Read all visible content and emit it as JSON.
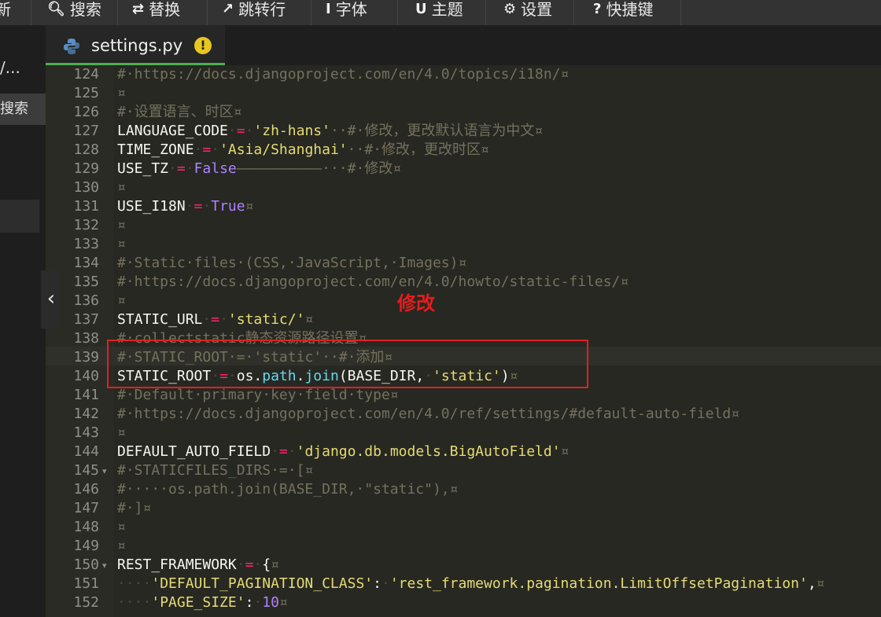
{
  "toolbar": {
    "items": [
      {
        "label": "新",
        "icon": ""
      },
      {
        "label": "搜索",
        "icon": "search-icon"
      },
      {
        "label": "替换",
        "icon": "replace-icon"
      },
      {
        "label": "跳转行",
        "icon": "pin-icon"
      },
      {
        "label": "字体",
        "icon": "font-icon"
      },
      {
        "label": "主题",
        "icon": "theme-icon"
      },
      {
        "label": "设置",
        "icon": "gear-icon"
      },
      {
        "label": "快捷键",
        "icon": "help-icon"
      }
    ]
  },
  "sidebar": {
    "title": "/...",
    "search_label": "搜索"
  },
  "tab": {
    "filename": "settings.py",
    "status_icon": "warning-icon"
  },
  "annotation": {
    "note": "修改"
  },
  "colors": {
    "comment": "#75715e",
    "string": "#e6db74",
    "operator": "#f92672",
    "constant": "#ae81ff",
    "function": "#66d9ef",
    "highlight_box": "#e02020"
  },
  "editor": {
    "lines": [
      {
        "n": "124",
        "t": [
          {
            "c": "c",
            "v": "#·https://docs.djangoproject.com/en/4.0/topics/i18n/¤"
          }
        ]
      },
      {
        "n": "125",
        "t": [
          {
            "c": "c",
            "v": "¤"
          }
        ]
      },
      {
        "n": "126",
        "t": [
          {
            "c": "c",
            "v": "#·设置语言、时区¤"
          }
        ]
      },
      {
        "n": "127",
        "t": [
          {
            "c": "",
            "v": "LANGUAGE_CODE"
          },
          {
            "c": "w",
            "v": "·"
          },
          {
            "c": "o",
            "v": "="
          },
          {
            "c": "w",
            "v": "·"
          },
          {
            "c": "s",
            "v": "'zh-hans'"
          },
          {
            "c": "c",
            "v": "··#·修改，更改默认语言为中文¤"
          }
        ]
      },
      {
        "n": "128",
        "t": [
          {
            "c": "",
            "v": "TIME_ZONE"
          },
          {
            "c": "w",
            "v": "·"
          },
          {
            "c": "o",
            "v": "="
          },
          {
            "c": "w",
            "v": "·"
          },
          {
            "c": "s",
            "v": "'Asia/Shanghai'"
          },
          {
            "c": "c",
            "v": "··#·修改，更改时区¤"
          }
        ]
      },
      {
        "n": "129",
        "t": [
          {
            "c": "",
            "v": "USE_TZ"
          },
          {
            "c": "w",
            "v": "·"
          },
          {
            "c": "o",
            "v": "="
          },
          {
            "c": "w",
            "v": "·"
          },
          {
            "c": "k",
            "v": "False"
          },
          {
            "c": "c",
            "v": "——————————···#·修改¤"
          }
        ]
      },
      {
        "n": "130",
        "t": [
          {
            "c": "c",
            "v": "¤"
          }
        ]
      },
      {
        "n": "131",
        "t": [
          {
            "c": "",
            "v": "USE_I18N"
          },
          {
            "c": "w",
            "v": "·"
          },
          {
            "c": "o",
            "v": "="
          },
          {
            "c": "w",
            "v": "·"
          },
          {
            "c": "k",
            "v": "True"
          },
          {
            "c": "c",
            "v": "¤"
          }
        ]
      },
      {
        "n": "132",
        "t": [
          {
            "c": "c",
            "v": "¤"
          }
        ]
      },
      {
        "n": "133",
        "t": [
          {
            "c": "c",
            "v": "¤"
          }
        ]
      },
      {
        "n": "134",
        "t": [
          {
            "c": "c",
            "v": "#·Static·files·(CSS,·JavaScript,·Images)¤"
          }
        ]
      },
      {
        "n": "135",
        "t": [
          {
            "c": "c",
            "v": "#·https://docs.djangoproject.com/en/4.0/howto/static-files/¤"
          }
        ]
      },
      {
        "n": "136",
        "t": [
          {
            "c": "c",
            "v": "¤"
          }
        ]
      },
      {
        "n": "137",
        "t": [
          {
            "c": "",
            "v": "STATIC_URL"
          },
          {
            "c": "w",
            "v": "·"
          },
          {
            "c": "o",
            "v": "="
          },
          {
            "c": "w",
            "v": "·"
          },
          {
            "c": "s",
            "v": "'static/'"
          },
          {
            "c": "c",
            "v": "¤"
          }
        ]
      },
      {
        "n": "138",
        "t": [
          {
            "c": "c",
            "v": "#·collectstatic静态资源路径设置¤"
          }
        ]
      },
      {
        "n": "139",
        "t": [
          {
            "c": "c",
            "v": "#·STATIC_ROOT·=·'static'··#·添加¤"
          }
        ]
      },
      {
        "n": "140",
        "t": [
          {
            "c": "",
            "v": "STATIC_ROOT"
          },
          {
            "c": "w",
            "v": "·"
          },
          {
            "c": "o",
            "v": "="
          },
          {
            "c": "w",
            "v": "·"
          },
          {
            "c": "",
            "v": "os."
          },
          {
            "c": "f",
            "v": "path"
          },
          {
            "c": "",
            "v": "."
          },
          {
            "c": "f",
            "v": "join"
          },
          {
            "c": "",
            "v": "(BASE_DIR,"
          },
          {
            "c": "w",
            "v": "·"
          },
          {
            "c": "s",
            "v": "'static'"
          },
          {
            "c": "",
            "v": ")"
          },
          {
            "c": "c",
            "v": "¤"
          }
        ]
      },
      {
        "n": "141",
        "t": [
          {
            "c": "c",
            "v": "#·Default·primary·key·field·type¤"
          }
        ]
      },
      {
        "n": "142",
        "t": [
          {
            "c": "c",
            "v": "#·https://docs.djangoproject.com/en/4.0/ref/settings/#default-auto-field¤"
          }
        ]
      },
      {
        "n": "143",
        "t": [
          {
            "c": "c",
            "v": "¤"
          }
        ]
      },
      {
        "n": "144",
        "t": [
          {
            "c": "",
            "v": "DEFAULT_AUTO_FIELD"
          },
          {
            "c": "w",
            "v": "·"
          },
          {
            "c": "o",
            "v": "="
          },
          {
            "c": "w",
            "v": "·"
          },
          {
            "c": "s",
            "v": "'django.db.models.BigAutoField'"
          },
          {
            "c": "c",
            "v": "¤"
          }
        ]
      },
      {
        "n": "145",
        "fold": true,
        "t": [
          {
            "c": "c",
            "v": "#·STATICFILES_DIRS·=·[¤"
          }
        ]
      },
      {
        "n": "146",
        "t": [
          {
            "c": "c",
            "v": "#·····os.path.join(BASE_DIR,·\"static\"),¤"
          }
        ]
      },
      {
        "n": "147",
        "t": [
          {
            "c": "c",
            "v": "#·]¤"
          }
        ]
      },
      {
        "n": "148",
        "t": [
          {
            "c": "c",
            "v": "¤"
          }
        ]
      },
      {
        "n": "149",
        "t": [
          {
            "c": "c",
            "v": "¤"
          }
        ]
      },
      {
        "n": "150",
        "fold": true,
        "t": [
          {
            "c": "",
            "v": "REST_FRAMEWORK"
          },
          {
            "c": "w",
            "v": "·"
          },
          {
            "c": "o",
            "v": "="
          },
          {
            "c": "w",
            "v": "·"
          },
          {
            "c": "",
            "v": "{"
          },
          {
            "c": "c",
            "v": "¤"
          }
        ]
      },
      {
        "n": "151",
        "t": [
          {
            "c": "w",
            "v": "····"
          },
          {
            "c": "s",
            "v": "'DEFAULT_PAGINATION_CLASS'"
          },
          {
            "c": "",
            "v": ":"
          },
          {
            "c": "w",
            "v": "·"
          },
          {
            "c": "s",
            "v": "'rest_framework.pagination.LimitOffsetPagination'"
          },
          {
            "c": "",
            "v": ","
          },
          {
            "c": "c",
            "v": "¤"
          }
        ]
      },
      {
        "n": "152",
        "t": [
          {
            "c": "w",
            "v": "····"
          },
          {
            "c": "s",
            "v": "'PAGE_SIZE'"
          },
          {
            "c": "",
            "v": ":"
          },
          {
            "c": "w",
            "v": "·"
          },
          {
            "c": "k",
            "v": "10"
          },
          {
            "c": "c",
            "v": "¤"
          }
        ]
      }
    ]
  }
}
